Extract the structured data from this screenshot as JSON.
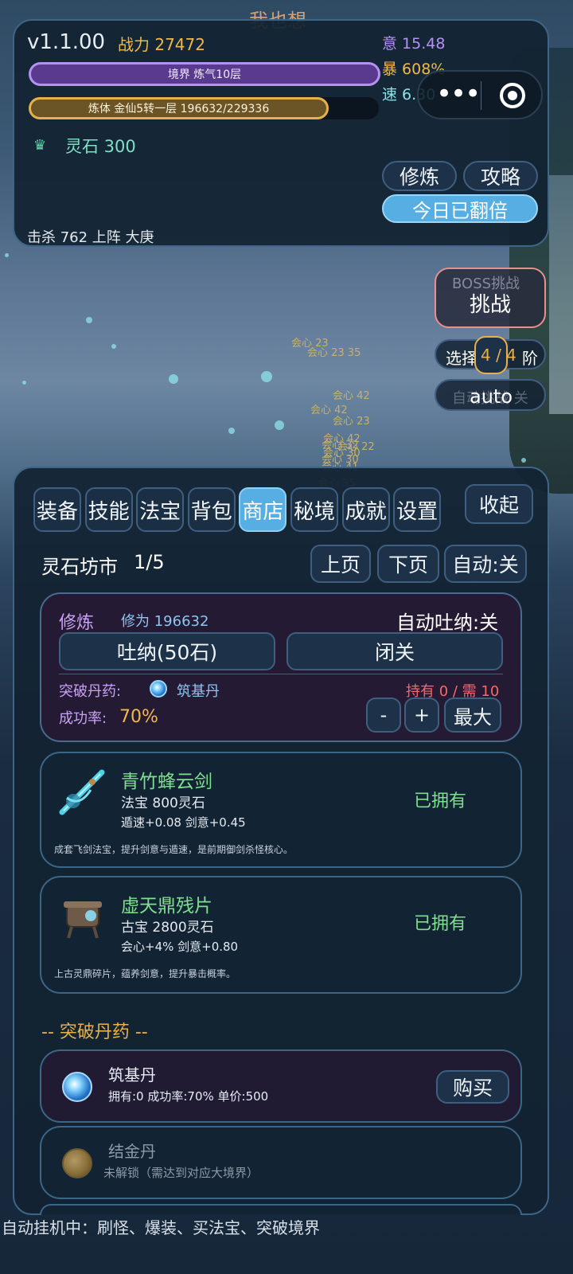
{
  "header": {
    "player_name": "我也想",
    "version": "v1.1.00",
    "power_label": "战力 27472",
    "realm_bar": "境界 炼气10层",
    "body_bar": "炼体 金仙5转一层 196632/229336",
    "body_progress": 0.857,
    "spirit_stone": "灵石 300",
    "stats": {
      "yi": "意 15.48",
      "bao": "暴 608%",
      "su": "速 6.30"
    },
    "kills": "击杀 762  上阵 大庚",
    "btn_cultivate": "修炼",
    "btn_guide": "攻略",
    "btn_double": "今日已翻倍"
  },
  "capsule": {
    "more_icon": "more-dots-icon",
    "close_icon": "target-circle-icon"
  },
  "boss": {
    "title": "BOSS挑战",
    "button": "挑战",
    "select_label": "选择",
    "stage": "4 / 4",
    "stage_suffix": "阶",
    "auto_bg": "自动挑战 关",
    "auto_label": "auto"
  },
  "floating_texts": [
    "会心 23",
    "会心 23 35",
    "会心 42",
    "会心 42",
    "会心 30",
    "会心 22",
    "会心 23",
    "会心 42",
    "会心 32",
    "会心 30",
    "会心 41",
    "会心 35"
  ],
  "tabs": [
    "装备",
    "技能",
    "法宝",
    "背包",
    "商店",
    "秘境",
    "成就",
    "设置"
  ],
  "active_tab": 4,
  "collapse_label": "收起",
  "shop": {
    "title": "灵石坊市",
    "page": "1/5",
    "prev": "上页",
    "next": "下页",
    "auto": "自动:关"
  },
  "cultivation": {
    "title": "修炼",
    "xiuwei": "修为 196632",
    "auto_breath": "自动吐纳:关",
    "breath_btn": "吐纳(50石)",
    "seclusion_btn": "闭关",
    "pill_label": "突破丹药:",
    "pill_name": "筑基丹",
    "hold": "持有 0 / 需 10",
    "rate_label": "成功率:",
    "rate_value": "70%",
    "minus": "-",
    "plus": "+",
    "max": "最大"
  },
  "items": [
    {
      "name": "青竹蜂云剑",
      "type_price": "法宝  800灵石",
      "stats": "遁速+0.08  剑意+0.45",
      "status": "已拥有",
      "desc": "成套飞剑法宝，提升剑意与遁速，是前期御剑杀怪核心。",
      "icon": "sword-icon"
    },
    {
      "name": "虚天鼎残片",
      "type_price": "古宝  2800灵石",
      "stats": "会心+4%  剑意+0.80",
      "status": "已拥有",
      "desc": "上古灵鼎碎片，蕴养剑意，提升暴击概率。",
      "icon": "cauldron-icon"
    }
  ],
  "pill_section_title": "-- 突破丹药 --",
  "pills": [
    {
      "name": "筑基丹",
      "info": "拥有:0  成功率:70%  单价:500",
      "buy": "购买",
      "icon": "taiji-pill-icon"
    },
    {
      "name": "结金丹",
      "info": "未解锁（需达到对应大境界）",
      "icon": "golden-pill-icon"
    }
  ],
  "footer_status": "自动挂机中：刷怪、爆装、买法宝、突破境界",
  "colors": {
    "accent_blue": "#57aee3",
    "gold": "#f0b94a",
    "green": "#7ee08e",
    "purple": "#b592f2",
    "red": "#f26a6a"
  }
}
